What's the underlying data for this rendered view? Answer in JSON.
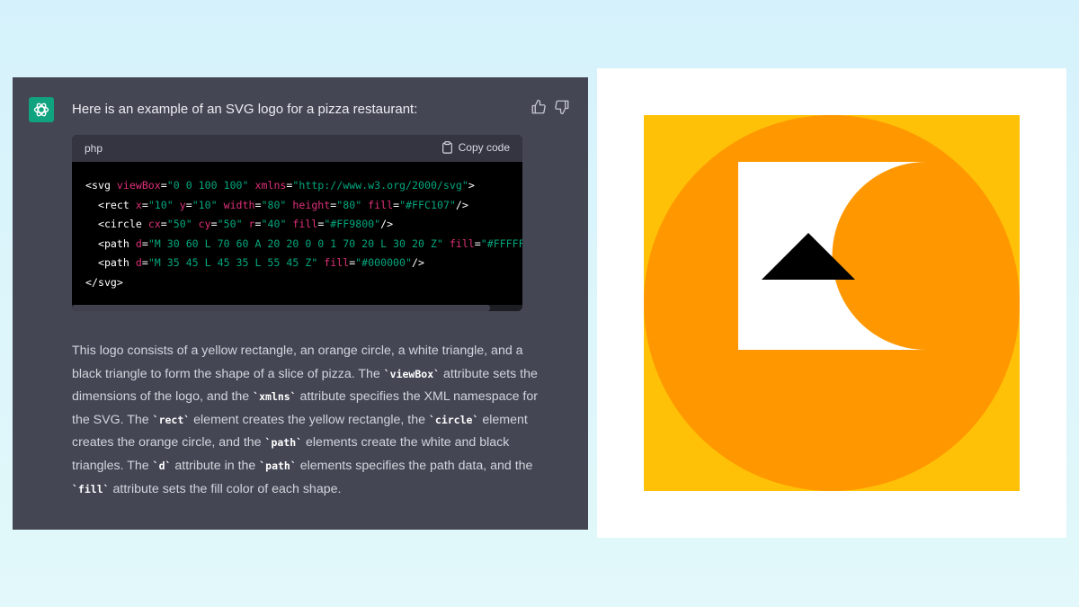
{
  "chat": {
    "intro": "Here is an example of an SVG logo for a pizza restaurant:",
    "assistant_icon": "openai-logo-icon",
    "feedback_icons": [
      "thumbs-up-icon",
      "thumbs-down-icon"
    ]
  },
  "code_block": {
    "language": "php",
    "copy_label": "Copy code",
    "copy_icon": "clipboard-icon",
    "lines": [
      [
        {
          "t": "<svg ",
          "c": "plain"
        },
        {
          "t": "viewBox",
          "c": "attr"
        },
        {
          "t": "=",
          "c": "plain"
        },
        {
          "t": "\"0 0 100 100\"",
          "c": "str"
        },
        {
          "t": " ",
          "c": "plain"
        },
        {
          "t": "xmlns",
          "c": "attr"
        },
        {
          "t": "=",
          "c": "plain"
        },
        {
          "t": "\"http://www.w3.org/2000/svg\"",
          "c": "str"
        },
        {
          "t": ">",
          "c": "plain"
        }
      ],
      [
        {
          "t": "  <rect ",
          "c": "plain"
        },
        {
          "t": "x",
          "c": "attr"
        },
        {
          "t": "=",
          "c": "plain"
        },
        {
          "t": "\"10\"",
          "c": "str"
        },
        {
          "t": " ",
          "c": "plain"
        },
        {
          "t": "y",
          "c": "attr"
        },
        {
          "t": "=",
          "c": "plain"
        },
        {
          "t": "\"10\"",
          "c": "str"
        },
        {
          "t": " ",
          "c": "plain"
        },
        {
          "t": "width",
          "c": "attr"
        },
        {
          "t": "=",
          "c": "plain"
        },
        {
          "t": "\"80\"",
          "c": "str"
        },
        {
          "t": " ",
          "c": "plain"
        },
        {
          "t": "height",
          "c": "attr"
        },
        {
          "t": "=",
          "c": "plain"
        },
        {
          "t": "\"80\"",
          "c": "str"
        },
        {
          "t": " ",
          "c": "plain"
        },
        {
          "t": "fill",
          "c": "attr"
        },
        {
          "t": "=",
          "c": "plain"
        },
        {
          "t": "\"#FFC107\"",
          "c": "str"
        },
        {
          "t": "/>",
          "c": "plain"
        }
      ],
      [
        {
          "t": "  <circle ",
          "c": "plain"
        },
        {
          "t": "cx",
          "c": "attr"
        },
        {
          "t": "=",
          "c": "plain"
        },
        {
          "t": "\"50\"",
          "c": "str"
        },
        {
          "t": " ",
          "c": "plain"
        },
        {
          "t": "cy",
          "c": "attr"
        },
        {
          "t": "=",
          "c": "plain"
        },
        {
          "t": "\"50\"",
          "c": "str"
        },
        {
          "t": " ",
          "c": "plain"
        },
        {
          "t": "r",
          "c": "attr"
        },
        {
          "t": "=",
          "c": "plain"
        },
        {
          "t": "\"40\"",
          "c": "str"
        },
        {
          "t": " ",
          "c": "plain"
        },
        {
          "t": "fill",
          "c": "attr"
        },
        {
          "t": "=",
          "c": "plain"
        },
        {
          "t": "\"#FF9800\"",
          "c": "str"
        },
        {
          "t": "/>",
          "c": "plain"
        }
      ],
      [
        {
          "t": "  <path ",
          "c": "plain"
        },
        {
          "t": "d",
          "c": "attr"
        },
        {
          "t": "=",
          "c": "plain"
        },
        {
          "t": "\"M 30 60 L 70 60 A 20 20 0 0 1 70 20 L 30 20 Z\"",
          "c": "str"
        },
        {
          "t": " ",
          "c": "plain"
        },
        {
          "t": "fill",
          "c": "attr"
        },
        {
          "t": "=",
          "c": "plain"
        },
        {
          "t": "\"#FFFFFF\"",
          "c": "str"
        },
        {
          "t": "/>",
          "c": "plain"
        }
      ],
      [
        {
          "t": "  <path ",
          "c": "plain"
        },
        {
          "t": "d",
          "c": "attr"
        },
        {
          "t": "=",
          "c": "plain"
        },
        {
          "t": "\"M 35 45 L 45 35 L 55 45 Z\"",
          "c": "str"
        },
        {
          "t": " ",
          "c": "plain"
        },
        {
          "t": "fill",
          "c": "attr"
        },
        {
          "t": "=",
          "c": "plain"
        },
        {
          "t": "\"#000000\"",
          "c": "str"
        },
        {
          "t": "/>",
          "c": "plain"
        }
      ],
      [
        {
          "t": "</svg>",
          "c": "plain"
        }
      ]
    ]
  },
  "explanation": [
    {
      "t": "This logo consists of a yellow rectangle, an orange circle, a white triangle, and a black triangle to form the shape of a slice of pizza. The ",
      "code": false
    },
    {
      "t": "`viewBox`",
      "code": true
    },
    {
      "t": " attribute sets the dimensions of the logo, and the ",
      "code": false
    },
    {
      "t": "`xmlns`",
      "code": true
    },
    {
      "t": " attribute specifies the XML namespace for the SVG. The ",
      "code": false
    },
    {
      "t": "`rect`",
      "code": true
    },
    {
      "t": " element creates the yellow rectangle, the ",
      "code": false
    },
    {
      "t": "`circle`",
      "code": true
    },
    {
      "t": " element creates the orange circle, and the ",
      "code": false
    },
    {
      "t": "`path`",
      "code": true
    },
    {
      "t": " elements create the white and black triangles. The ",
      "code": false
    },
    {
      "t": "`d`",
      "code": true
    },
    {
      "t": " attribute in the ",
      "code": false
    },
    {
      "t": "`path`",
      "code": true
    },
    {
      "t": " elements specifies the path data, and the ",
      "code": false
    },
    {
      "t": "`fill`",
      "code": true
    },
    {
      "t": " attribute sets the fill color of each shape.",
      "code": false
    }
  ],
  "logo": {
    "colors": {
      "rect": "#FFC107",
      "circle": "#FF9800",
      "white_shape": "#FFFFFF",
      "black_triangle": "#000000"
    }
  },
  "theme": {
    "panel": "#444654",
    "code_bg": "#000000",
    "token_attr": "#df3079",
    "token_string": "#00a67d",
    "accent": "#10a37f"
  }
}
